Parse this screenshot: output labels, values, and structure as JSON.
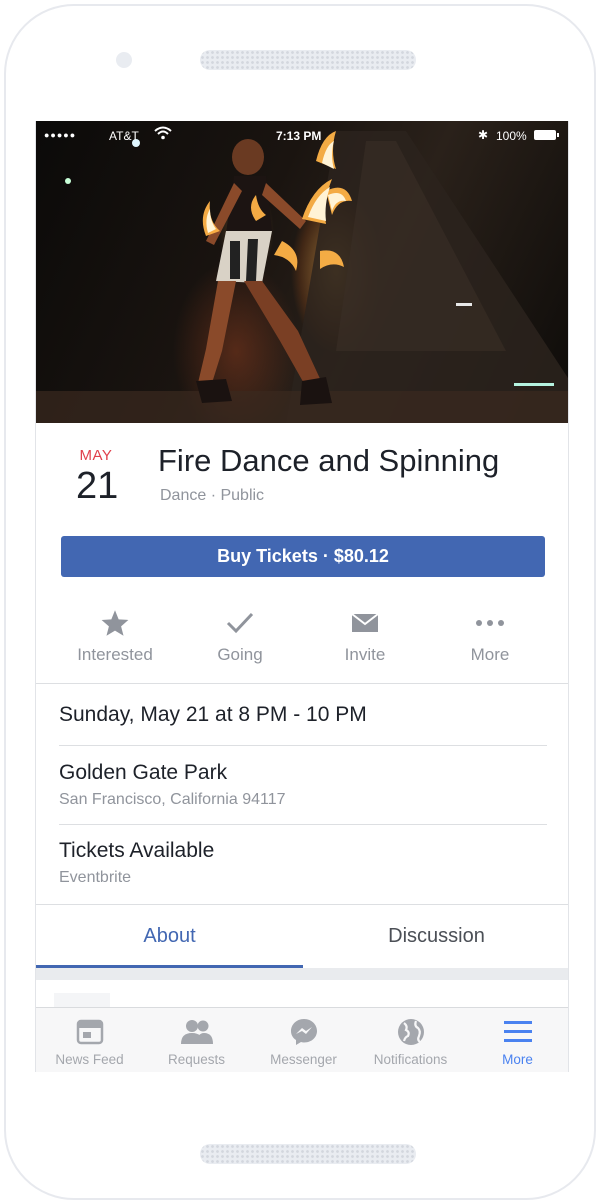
{
  "status_bar": {
    "signal": "●●●●●",
    "carrier": "AT&T",
    "time": "7:13 PM",
    "battery": "100%"
  },
  "event": {
    "month": "MAY",
    "day": "21",
    "title": "Fire Dance and Spinning",
    "meta": "Dance · Public",
    "buy_button": "Buy Tickets · $80.12"
  },
  "actions": [
    {
      "label": "Interested",
      "icon": "star-icon"
    },
    {
      "label": "Going",
      "icon": "check-icon"
    },
    {
      "label": "Invite",
      "icon": "envelope-icon"
    },
    {
      "label": "More",
      "icon": "more-icon"
    }
  ],
  "details": {
    "datetime": "Sunday, May 21 at 8 PM - 10 PM",
    "location_name": "Golden Gate Park",
    "location_address": "San Francisco, California 94117",
    "tickets_title": "Tickets Available",
    "tickets_source": "Eventbrite"
  },
  "tabs": {
    "about": "About",
    "discussion": "Discussion",
    "active": "About"
  },
  "tabbar": [
    {
      "label": "News Feed",
      "icon": "news-feed-icon"
    },
    {
      "label": "Requests",
      "icon": "requests-icon"
    },
    {
      "label": "Messenger",
      "icon": "messenger-icon"
    },
    {
      "label": "Notifications",
      "icon": "globe-icon"
    },
    {
      "label": "More",
      "icon": "hamburger-icon",
      "active": true
    }
  ],
  "colors": {
    "brand_blue": "#4267b2",
    "date_red": "#e0404c",
    "active_tab_blue": "#4a82f0"
  }
}
